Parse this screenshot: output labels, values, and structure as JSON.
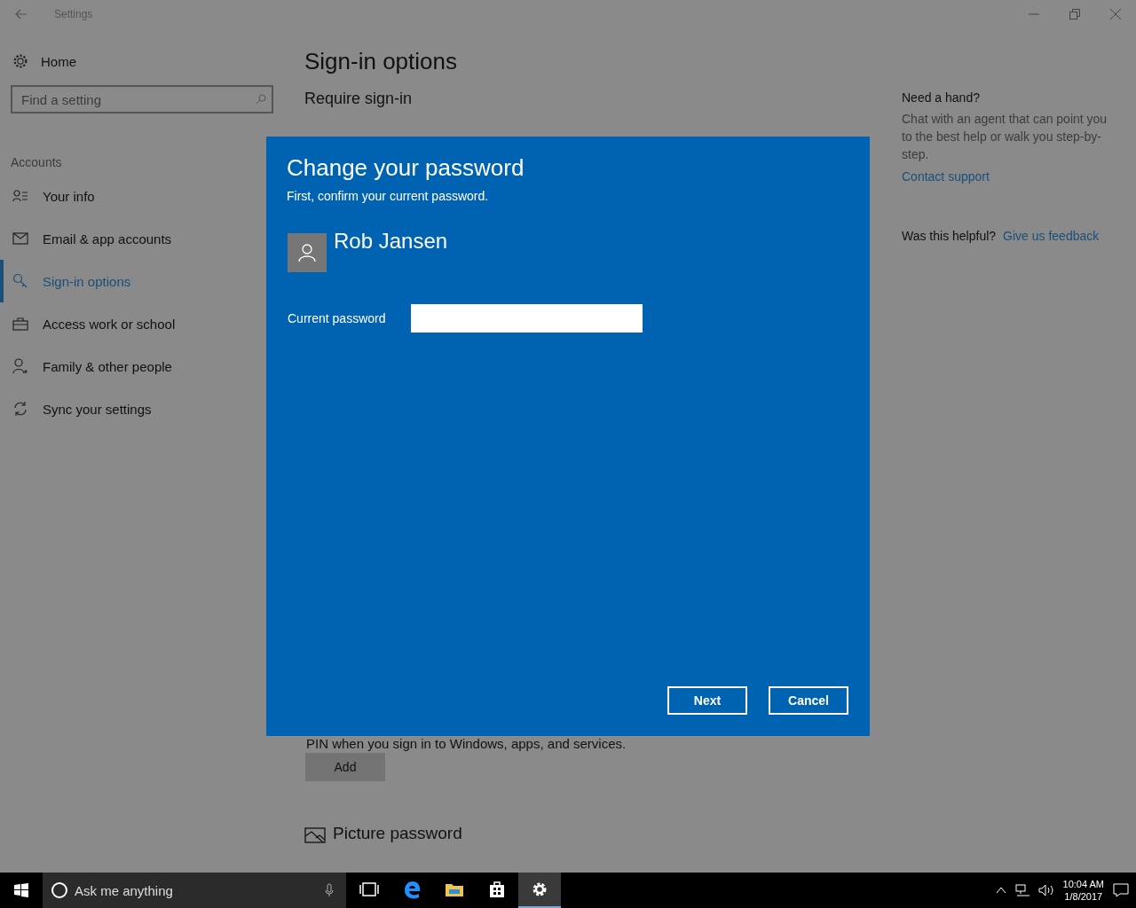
{
  "window": {
    "title": "Settings"
  },
  "sidebar": {
    "home": "Home",
    "search": {
      "placeholder": "Find a setting"
    },
    "section": "Accounts",
    "items": [
      {
        "label": "Your info",
        "selected": false
      },
      {
        "label": "Email & app accounts",
        "selected": false
      },
      {
        "label": "Sign-in options",
        "selected": true
      },
      {
        "label": "Access work or school",
        "selected": false
      },
      {
        "label": "Family & other people",
        "selected": false
      },
      {
        "label": "Sync your settings",
        "selected": false
      }
    ]
  },
  "main": {
    "title": "Sign-in options",
    "subtitle": "Require sign-in",
    "pin_text": "PIN when you sign in to Windows, apps, and services.",
    "add_button": "Add",
    "picture_heading": "Picture password"
  },
  "help": {
    "heading": "Need a hand?",
    "text": "Chat with an agent that can point you to the best help or walk you step-by-step.",
    "link": "Contact support",
    "feedback_question": "Was this helpful?",
    "feedback_link": "Give us feedback"
  },
  "dialog": {
    "title": "Change your password",
    "subtitle": "First, confirm your current password.",
    "user": "Rob Jansen",
    "field_label": "Current password",
    "buttons": [
      "Next",
      "Cancel"
    ]
  },
  "taskbar": {
    "search": {
      "placeholder": "Ask me anything"
    },
    "apps": [
      {
        "kind": "taskview",
        "selected": false
      },
      {
        "kind": "edge",
        "selected": false
      },
      {
        "kind": "explorer",
        "selected": false
      },
      {
        "kind": "store",
        "selected": false
      },
      {
        "kind": "settings",
        "selected": true
      }
    ],
    "time": "10:04 AM",
    "date": "1/8/2017"
  }
}
